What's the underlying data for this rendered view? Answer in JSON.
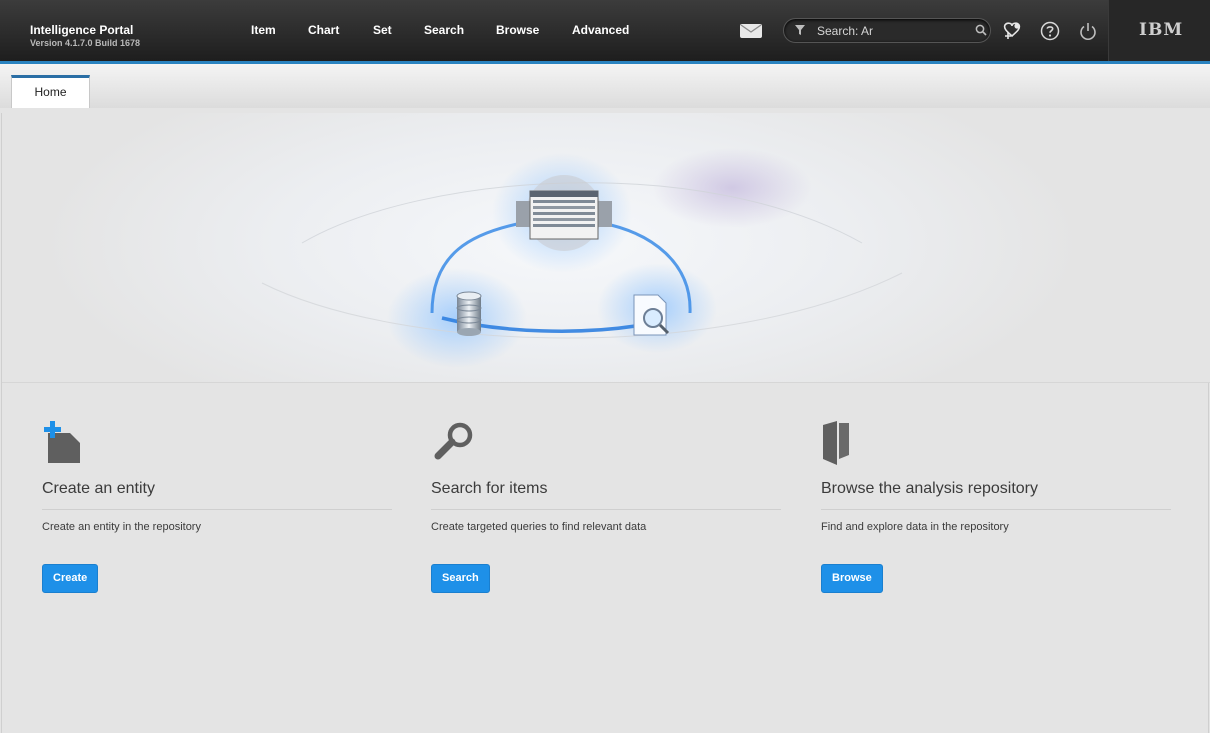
{
  "header": {
    "app_title": "Intelligence Portal",
    "version": "Version 4.1.7.0 Build 1678",
    "nav": [
      "Item",
      "Chart",
      "Set",
      "Search",
      "Browse",
      "Advanced"
    ],
    "search_placeholder": "Search: Ar",
    "icons": [
      "mail-icon",
      "filter-icon",
      "search-icon",
      "connections-icon",
      "help-icon",
      "power-icon"
    ],
    "logo": "IBM"
  },
  "tabs": [
    {
      "label": "Home",
      "active": true
    }
  ],
  "cards": [
    {
      "title": "Create an entity",
      "description": "Create an entity in the repository",
      "button": "Create",
      "icon": "create-entity-icon"
    },
    {
      "title": "Search for items",
      "description": "Create targeted queries to find relevant data",
      "button": "Search",
      "icon": "search-items-icon"
    },
    {
      "title": "Browse the analysis repository",
      "description": "Find and explore data in the repository",
      "button": "Browse",
      "icon": "folder-icon"
    }
  ],
  "colors": {
    "accent": "#2a83c0",
    "button": "#1e90e8",
    "topbar": "#2b2b2b"
  }
}
